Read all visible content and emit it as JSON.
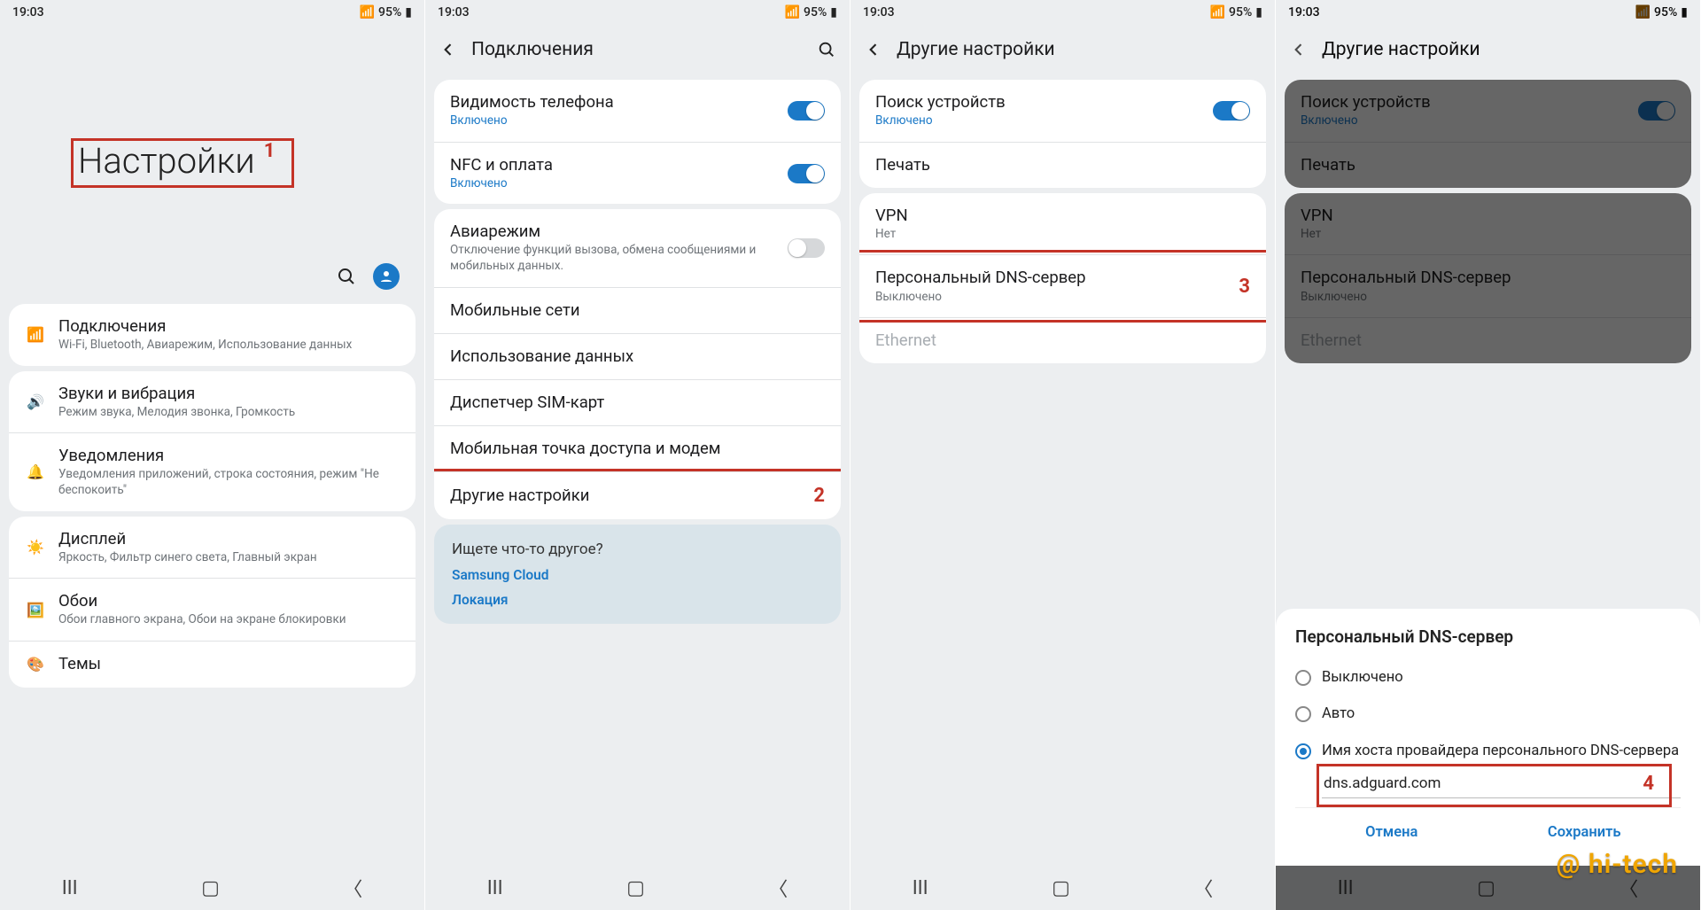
{
  "status": {
    "time": "19:03",
    "battery": "95%"
  },
  "p1": {
    "title": "Настройки",
    "annot": "1",
    "items": [
      {
        "icon": "wifi",
        "title": "Подключения",
        "sub": "Wi-Fi, Bluetooth, Авиарежим, Использование данных"
      },
      {
        "icon": "sound",
        "title": "Звуки и вибрация",
        "sub": "Режим звука, Мелодия звонка, Громкость"
      },
      {
        "icon": "notif",
        "title": "Уведомления",
        "sub": "Уведомления приложений, строка состояния, режим \"Не беспокоить\""
      },
      {
        "icon": "display",
        "title": "Дисплей",
        "sub": "Яркость, Фильтр синего света, Главный экран"
      },
      {
        "icon": "wall",
        "title": "Обои",
        "sub": "Обои главного экрана, Обои на экране блокировки"
      },
      {
        "icon": "theme",
        "title": "Темы",
        "sub": ""
      }
    ]
  },
  "p2": {
    "title": "Подключения",
    "group1": [
      {
        "title": "Видимость телефона",
        "sub": "Включено",
        "tog": true
      },
      {
        "title": "NFC и оплата",
        "sub": "Включено",
        "tog": true
      }
    ],
    "group2": [
      {
        "title": "Авиарежим",
        "sub": "Отключение функций вызова, обмена сообщениями и мобильных данных.",
        "tog": false
      },
      {
        "title": "Мобильные сети"
      },
      {
        "title": "Использование данных"
      },
      {
        "title": "Диспетчер SIM-карт"
      },
      {
        "title": "Мобильная точка доступа и модем"
      },
      {
        "title": "Другие настройки",
        "annot": "2"
      }
    ],
    "extra": {
      "q": "Ищете что-то другое?",
      "links": [
        "Samsung Cloud",
        "Локация"
      ]
    }
  },
  "p3": {
    "title": "Другие настройки",
    "group1": [
      {
        "title": "Поиск устройств",
        "sub": "Включено",
        "tog": true
      },
      {
        "title": "Печать"
      }
    ],
    "group2": [
      {
        "title": "VPN",
        "sub": "Нет"
      },
      {
        "title": "Персональный DNS-сервер",
        "sub": "Выключено",
        "annot": "3"
      },
      {
        "title": "Ethernet",
        "grey": true
      }
    ]
  },
  "p4": {
    "title": "Другие настройки",
    "group1": [
      {
        "title": "Поиск устройств",
        "sub": "Включено",
        "tog": true
      },
      {
        "title": "Печать"
      }
    ],
    "group2": [
      {
        "title": "VPN",
        "sub": "Нет"
      },
      {
        "title": "Персональный DNS-сервер",
        "sub": "Выключено"
      },
      {
        "title": "Ethernet",
        "grey": true
      }
    ],
    "dialog": {
      "title": "Персональный DNS-сервер",
      "opts": [
        "Выключено",
        "Авто",
        "Имя хоста провайдера персонального DNS-сервера"
      ],
      "input": "dns.adguard.com",
      "annot": "4",
      "cancel": "Отмена",
      "save": "Сохранить"
    }
  },
  "watermark": "@ hi-tech"
}
